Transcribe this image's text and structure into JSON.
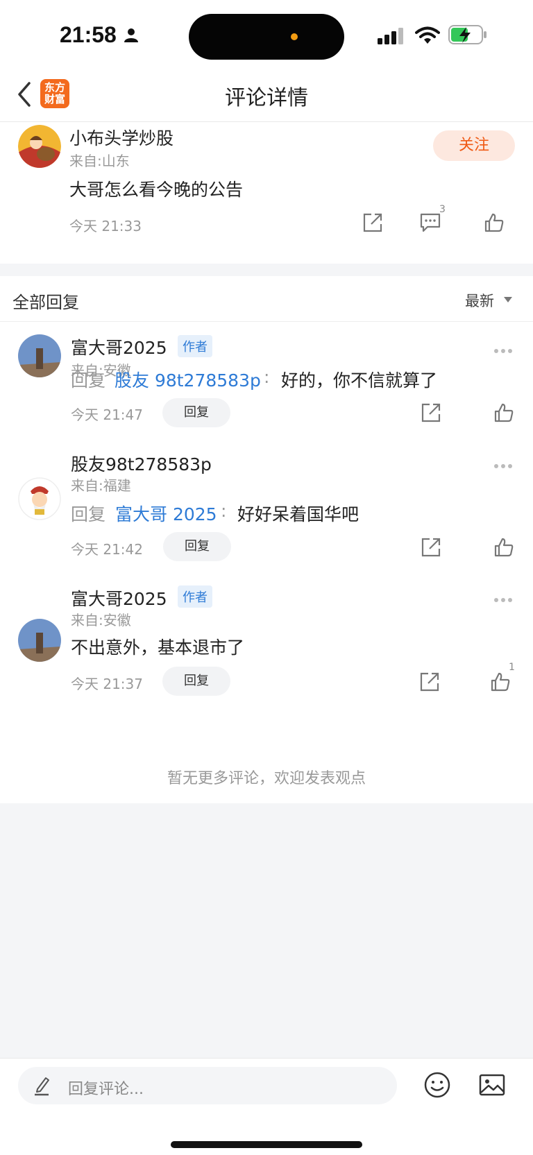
{
  "status_bar": {
    "time": "21:58"
  },
  "nav": {
    "logo_line1": "东方",
    "logo_line2": "财富",
    "title": "评论详情"
  },
  "main_comment": {
    "username": "小布头学炒股",
    "location": "来自:山东",
    "follow_label": "关注",
    "text": "大哥怎么看今晚的公告",
    "time": "今天 21:33",
    "reply_count": "3"
  },
  "replies": {
    "title": "全部回复",
    "sort_label": "最新",
    "author_badge": "作者",
    "reply_prefix": "回复",
    "reply_button": "回复",
    "items": [
      {
        "username": "富大哥2025",
        "location": "来自:安徽",
        "target": "股友 98t278583p",
        "text": "好的，你不信就算了",
        "time": "今天 21:47"
      },
      {
        "username": "股友98t278583p",
        "location": "来自:福建",
        "target": "富大哥 2025",
        "text": "好好呆着国华吧",
        "time": "今天 21:42"
      },
      {
        "username": "富大哥2025",
        "location": "来自:安徽",
        "text": "不出意外，基本退市了",
        "time": "今天 21:37",
        "like_count": "1"
      }
    ],
    "no_more": "暂无更多评论，欢迎发表观点"
  },
  "bottom_bar": {
    "placeholder": "回复评论..."
  },
  "colors": {
    "accent_orange": "#f05a14",
    "link_blue": "#2e7bd6",
    "background": "#f4f5f7"
  }
}
